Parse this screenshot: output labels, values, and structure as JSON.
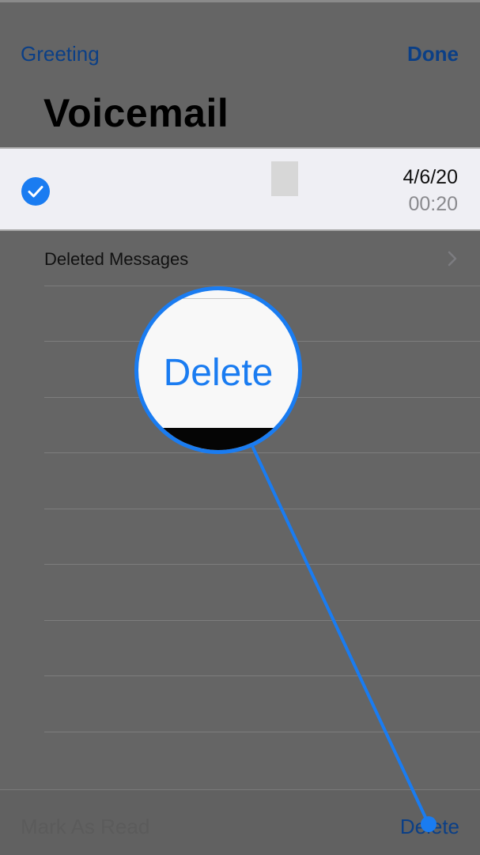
{
  "nav": {
    "left_label": "Greeting",
    "right_label": "Done"
  },
  "page": {
    "title": "Voicemail"
  },
  "voicemail_item": {
    "selected": true,
    "date": "4/6/20",
    "duration": "00:20"
  },
  "deleted_messages": {
    "label": "Deleted Messages"
  },
  "bottom_toolbar": {
    "left_label": "Mark As Read",
    "right_label": "Delete"
  },
  "callout": {
    "magnified_label": "Delete"
  },
  "colors": {
    "accent": "#1a7cf1",
    "dimmed_link": "#0b3f86",
    "overlay_background": "#656565",
    "selected_row_background": "#efeff4"
  },
  "icons": {
    "selection": "checkmark-circle-icon",
    "disclosure": "chevron-right-icon"
  }
}
